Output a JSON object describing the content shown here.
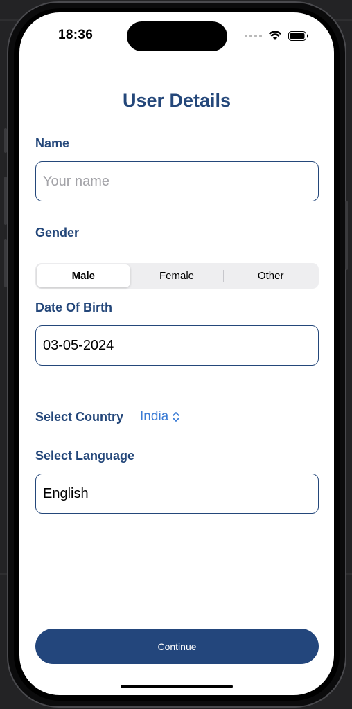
{
  "status_bar": {
    "time": "18:36"
  },
  "page": {
    "title": "User Details"
  },
  "name": {
    "label": "Name",
    "placeholder": "Your name",
    "value": ""
  },
  "gender": {
    "label": "Gender",
    "options": [
      "Male",
      "Female",
      "Other"
    ],
    "selected": "Male"
  },
  "dob": {
    "label": "Date Of Birth",
    "value": "03-05-2024"
  },
  "country": {
    "label": "Select Country",
    "value": "India",
    "icon": "chevron-up-down-icon"
  },
  "language": {
    "label": "Select Language",
    "value": "English"
  },
  "actions": {
    "continue_label": "Continue"
  },
  "colors": {
    "primary": "#24477a",
    "button": "#23467c",
    "link": "#3a7bd5",
    "segment_bg": "#eeeef0"
  }
}
